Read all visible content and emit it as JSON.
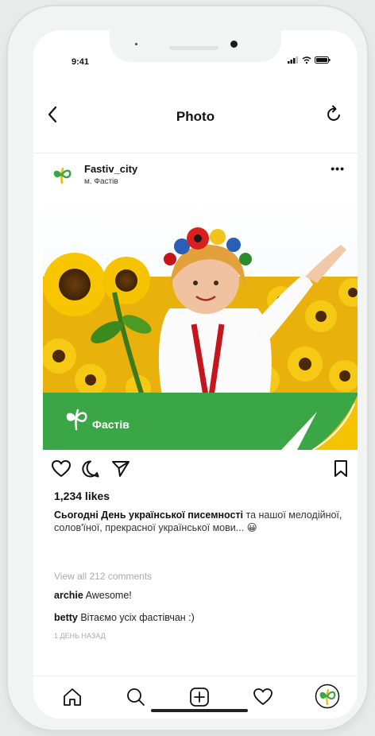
{
  "status": {
    "time": "9:41"
  },
  "nav": {
    "title": "Photo"
  },
  "post": {
    "username": "Fastiv_city",
    "location": "м. Фастів",
    "photo": {
      "brand": "Фастів",
      "green": "#3aa645",
      "yellow": "#f5c300"
    },
    "likes": "1,234 likes",
    "caption_bold": "Сьогодні День української писемності",
    "caption_rest": " та нашої мелодійної, солов'їної, прекрасної української мови... 😀",
    "view_all": "View all 212 comments",
    "comments": [
      {
        "user": "archie",
        "text": " Awesome!"
      },
      {
        "user": "betty",
        "text": " Вітаємо усіх фастівчан :)"
      }
    ],
    "time_ago": "1 день назад"
  },
  "icons": [
    "back-icon",
    "refresh-icon",
    "more-icon",
    "heart-icon",
    "comment-icon",
    "share-icon",
    "bookmark-icon",
    "home-icon",
    "search-icon",
    "add-icon",
    "activity-icon",
    "profile-icon"
  ]
}
